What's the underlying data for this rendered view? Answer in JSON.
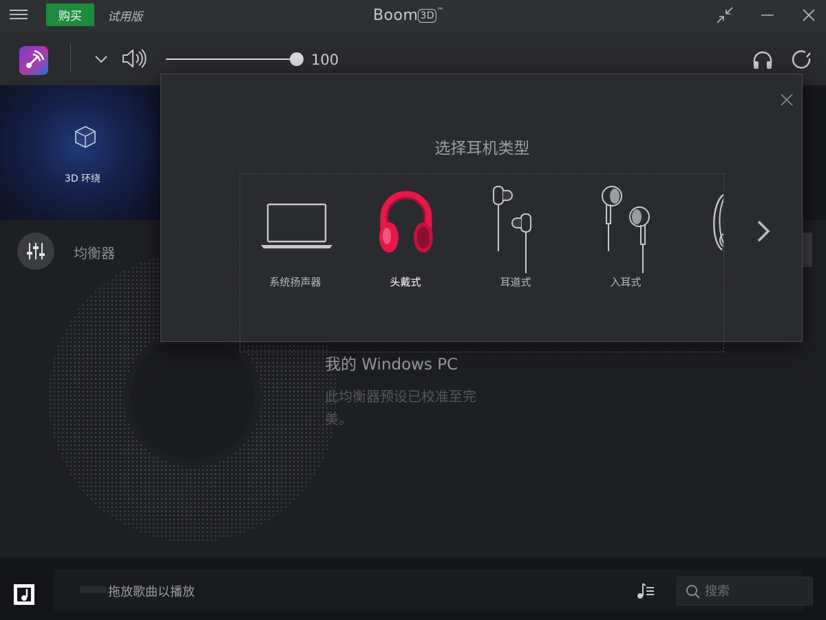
{
  "titlebar": {
    "buy_label": "购买",
    "trial_label": "试用版",
    "app_name": "Boom",
    "app_badge": "3D",
    "trademark": "™"
  },
  "toolbar": {
    "volume_value": "100",
    "volume_level_percent": 100
  },
  "effects": {
    "surround_label": "3D 环绕"
  },
  "equalizer": {
    "label": "均衡器",
    "preset_title": "我的 Windows PC",
    "preset_description": "此均衡器预设已校准至完美。"
  },
  "modal": {
    "title": "选择耳机类型",
    "options": [
      {
        "label": "系统扬声器",
        "icon": "laptop-icon",
        "selected": false
      },
      {
        "label": "头戴式",
        "icon": "over-ear-headphones-icon",
        "selected": true
      },
      {
        "label": "耳道式",
        "icon": "in-canal-earphones-icon",
        "selected": false
      },
      {
        "label": "入耳式",
        "icon": "earbuds-icon",
        "selected": false
      }
    ]
  },
  "bottombar": {
    "drop_text": "拖放歌曲以播放",
    "search_placeholder": "搜索"
  },
  "colors": {
    "accent": "#e8174a",
    "buy_green": "#1d8c3d",
    "surround_blue": "#1d3a7a"
  }
}
